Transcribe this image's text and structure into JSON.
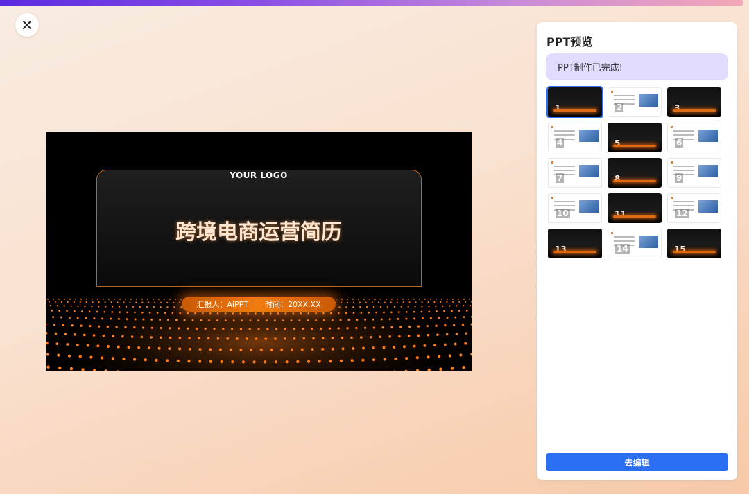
{
  "slide": {
    "logo": "YOUR LOGO",
    "title": "跨境电商运营简历",
    "reporter": "汇报人：AiPPT",
    "time": "时间：20XX.XX"
  },
  "panel": {
    "title": "PPT预览",
    "status": "PPT制作已完成!",
    "edit_button": "去编辑",
    "thumbnails": [
      {
        "num": "1",
        "style": "dark",
        "selected": true
      },
      {
        "num": "2",
        "style": "light"
      },
      {
        "num": "3",
        "style": "dark"
      },
      {
        "num": "4",
        "style": "light"
      },
      {
        "num": "5",
        "style": "dark"
      },
      {
        "num": "6",
        "style": "light"
      },
      {
        "num": "7",
        "style": "light"
      },
      {
        "num": "8",
        "style": "dark"
      },
      {
        "num": "9",
        "style": "light"
      },
      {
        "num": "10",
        "style": "light"
      },
      {
        "num": "11",
        "style": "dark"
      },
      {
        "num": "12",
        "style": "light"
      },
      {
        "num": "13",
        "style": "dark"
      },
      {
        "num": "14",
        "style": "light"
      },
      {
        "num": "15",
        "style": "dark"
      }
    ]
  },
  "colors": {
    "accent": "#2a6ff2",
    "brand_orange": "#f07b10",
    "status_bg": "#e1dcff"
  },
  "icons": {
    "close": "close-icon"
  }
}
